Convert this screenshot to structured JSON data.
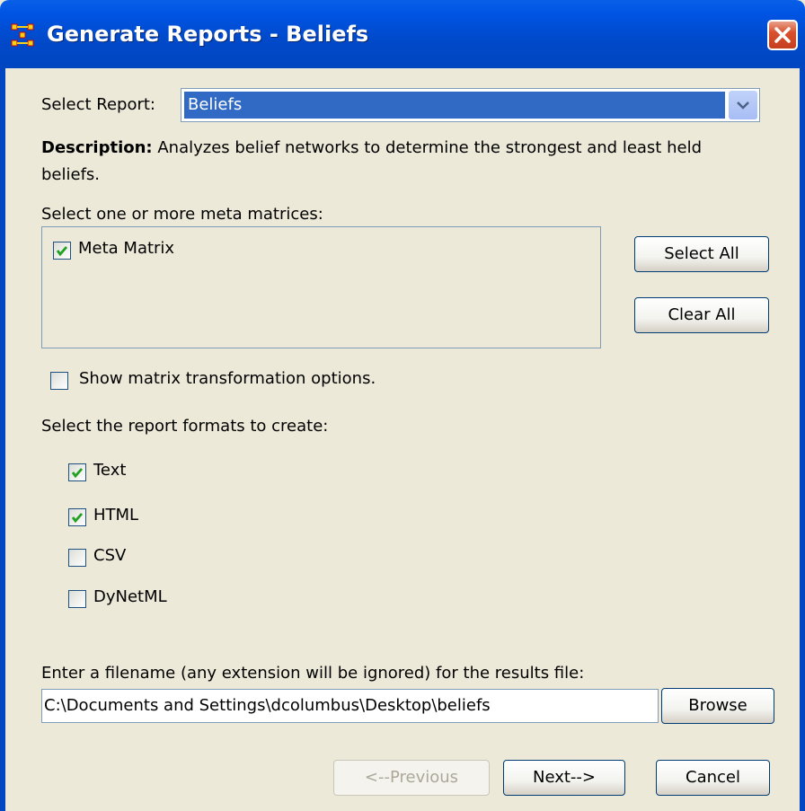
{
  "window": {
    "title": "Generate Reports - Beliefs"
  },
  "report": {
    "label": "Select Report:",
    "selected": "Beliefs"
  },
  "description": {
    "prefix": "Description:",
    "text": " Analyzes belief networks to determine the strongest and least held beliefs."
  },
  "meta": {
    "label": "Select one or more meta matrices:",
    "items": [
      {
        "label": "Meta Matrix",
        "checked": true
      }
    ],
    "select_all": "Select All",
    "clear_all": "Clear All"
  },
  "transform": {
    "label": "Show matrix transformation options.",
    "checked": false
  },
  "formats": {
    "label": "Select the report formats to create:",
    "items": [
      {
        "label": "Text",
        "checked": true
      },
      {
        "label": "HTML",
        "checked": true
      },
      {
        "label": "CSV",
        "checked": false
      },
      {
        "label": "DyNetML",
        "checked": false
      }
    ]
  },
  "file": {
    "label": "Enter a filename (any extension will be ignored) for the results file:",
    "value": "C:\\Documents and Settings\\dcolumbus\\Desktop\\beliefs",
    "browse": "Browse"
  },
  "nav": {
    "previous": "<--Previous",
    "next": "Next-->",
    "cancel": "Cancel"
  },
  "colors": {
    "titlebar": "#0054E3",
    "selection": "#316AC5",
    "dialog_bg": "#ECE9D8",
    "check": "#21A121"
  }
}
